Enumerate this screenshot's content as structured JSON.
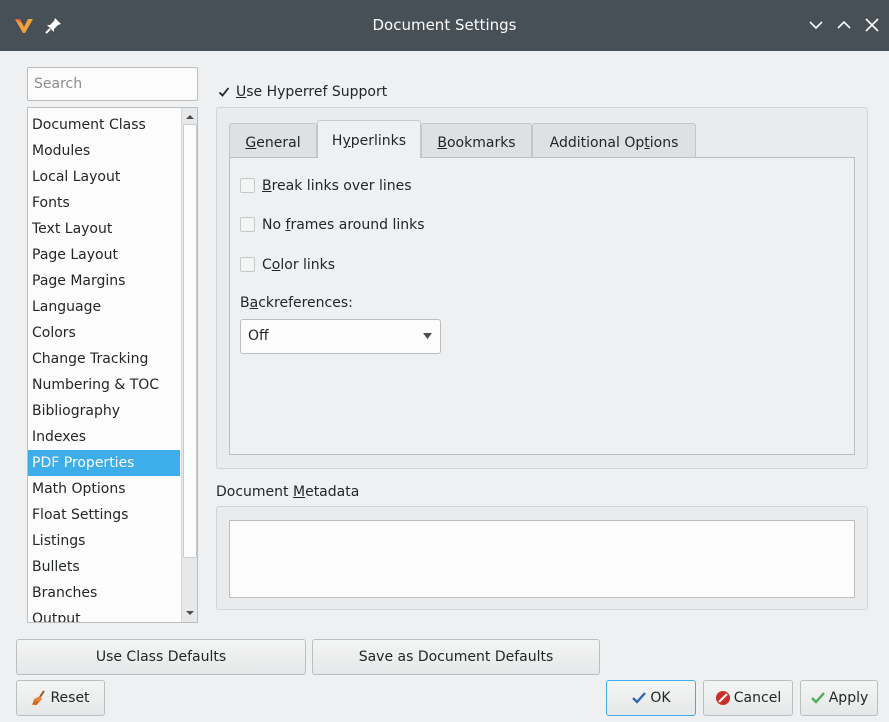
{
  "window": {
    "title": "Document Settings"
  },
  "search": {
    "placeholder": "Search"
  },
  "sidebar": {
    "items": [
      "Document Class",
      "Modules",
      "Local Layout",
      "Fonts",
      "Text Layout",
      "Page Layout",
      "Page Margins",
      "Language",
      "Colors",
      "Change Tracking",
      "Numbering & TOC",
      "Bibliography",
      "Indexes",
      "PDF Properties",
      "Math Options",
      "Float Settings",
      "Listings",
      "Bullets",
      "Branches",
      "Output"
    ],
    "selected": "PDF Properties"
  },
  "hyperref": {
    "pre": "",
    "key": "U",
    "post": "se Hyperref Support",
    "checked": true
  },
  "tabs": [
    {
      "pre": "",
      "key": "G",
      "post": "eneral"
    },
    {
      "pre": "H",
      "key": "y",
      "post": "perlinks"
    },
    {
      "pre": "",
      "key": "B",
      "post": "ookmarks"
    },
    {
      "pre": "Additional Op",
      "key": "t",
      "post": "ions"
    }
  ],
  "active_tab": "Hyperlinks",
  "options": {
    "break_links": {
      "pre": "",
      "key": "B",
      "post": "reak links over lines",
      "checked": false
    },
    "no_frames": {
      "pre": "No ",
      "key": "f",
      "post": "rames around links",
      "checked": false
    },
    "color_links": {
      "pre": "C",
      "key": "o",
      "post": "lor links",
      "checked": false
    }
  },
  "backreferences": {
    "pre": "B",
    "key": "a",
    "post": "ckreferences:",
    "value": "Off"
  },
  "metadata": {
    "pre": "Document ",
    "key": "M",
    "post": "etadata",
    "value": ""
  },
  "buttons": {
    "use_class_defaults": "Use Class Defaults",
    "save_doc_defaults": "Save as Document Defaults",
    "reset": "Reset",
    "ok": "OK",
    "cancel": "Cancel",
    "apply": "Apply"
  },
  "colors": {
    "titlebar": "#475057",
    "selection": "#3daee9",
    "ok_check": "#2d6cad",
    "cancel_red": "#c9302c",
    "apply_green": "#4caf50"
  },
  "icons": {
    "app": "lyx-logo-icon",
    "pin": "pin-icon",
    "minimize": "chevron-down-icon",
    "maximize": "chevron-up-icon",
    "close": "close-icon",
    "reset": "broom-icon",
    "ok": "check-icon",
    "cancel": "stop-icon",
    "apply": "check-icon"
  }
}
